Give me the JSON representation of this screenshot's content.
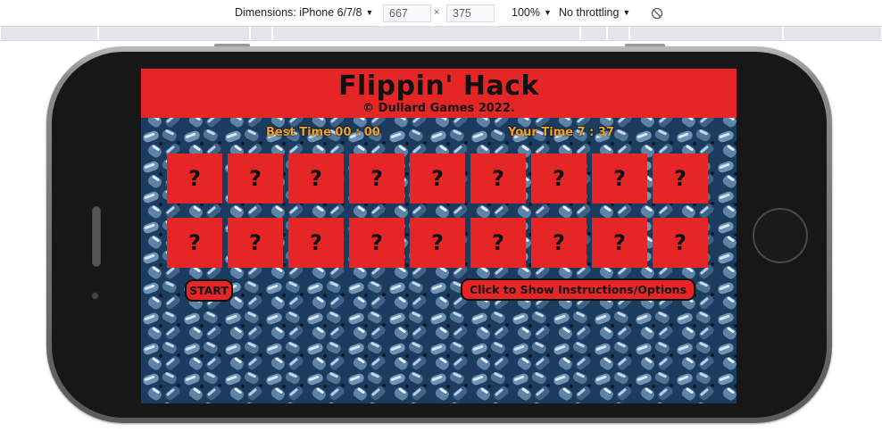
{
  "devtools": {
    "dimensions_label": "Dimensions: iPhone 6/7/8",
    "width_value": "667",
    "height_value": "375",
    "times_symbol": "×",
    "zoom_label": "100%",
    "throttling_label": "No throttling",
    "caret": "▼",
    "rotate_icon": "rotate-icon"
  },
  "game": {
    "title": "Flippin' Hack",
    "copyright": "© Dullard Games 2022.",
    "best_time": "Best Time 00 : 00",
    "your_time": "Your Time 7 : 37",
    "cards_row1": [
      "?",
      "?",
      "?",
      "?",
      "?",
      "?",
      "?",
      "?",
      "?"
    ],
    "cards_row2": [
      "?",
      "?",
      "?",
      "?",
      "?",
      "?",
      "?",
      "?",
      "?"
    ],
    "start_label": "START",
    "instructions_label": "Click to Show Instructions/Options",
    "colors": {
      "header_red": "#e62626",
      "time_orange": "#f4a020",
      "background_blue": "#1d4266"
    }
  }
}
